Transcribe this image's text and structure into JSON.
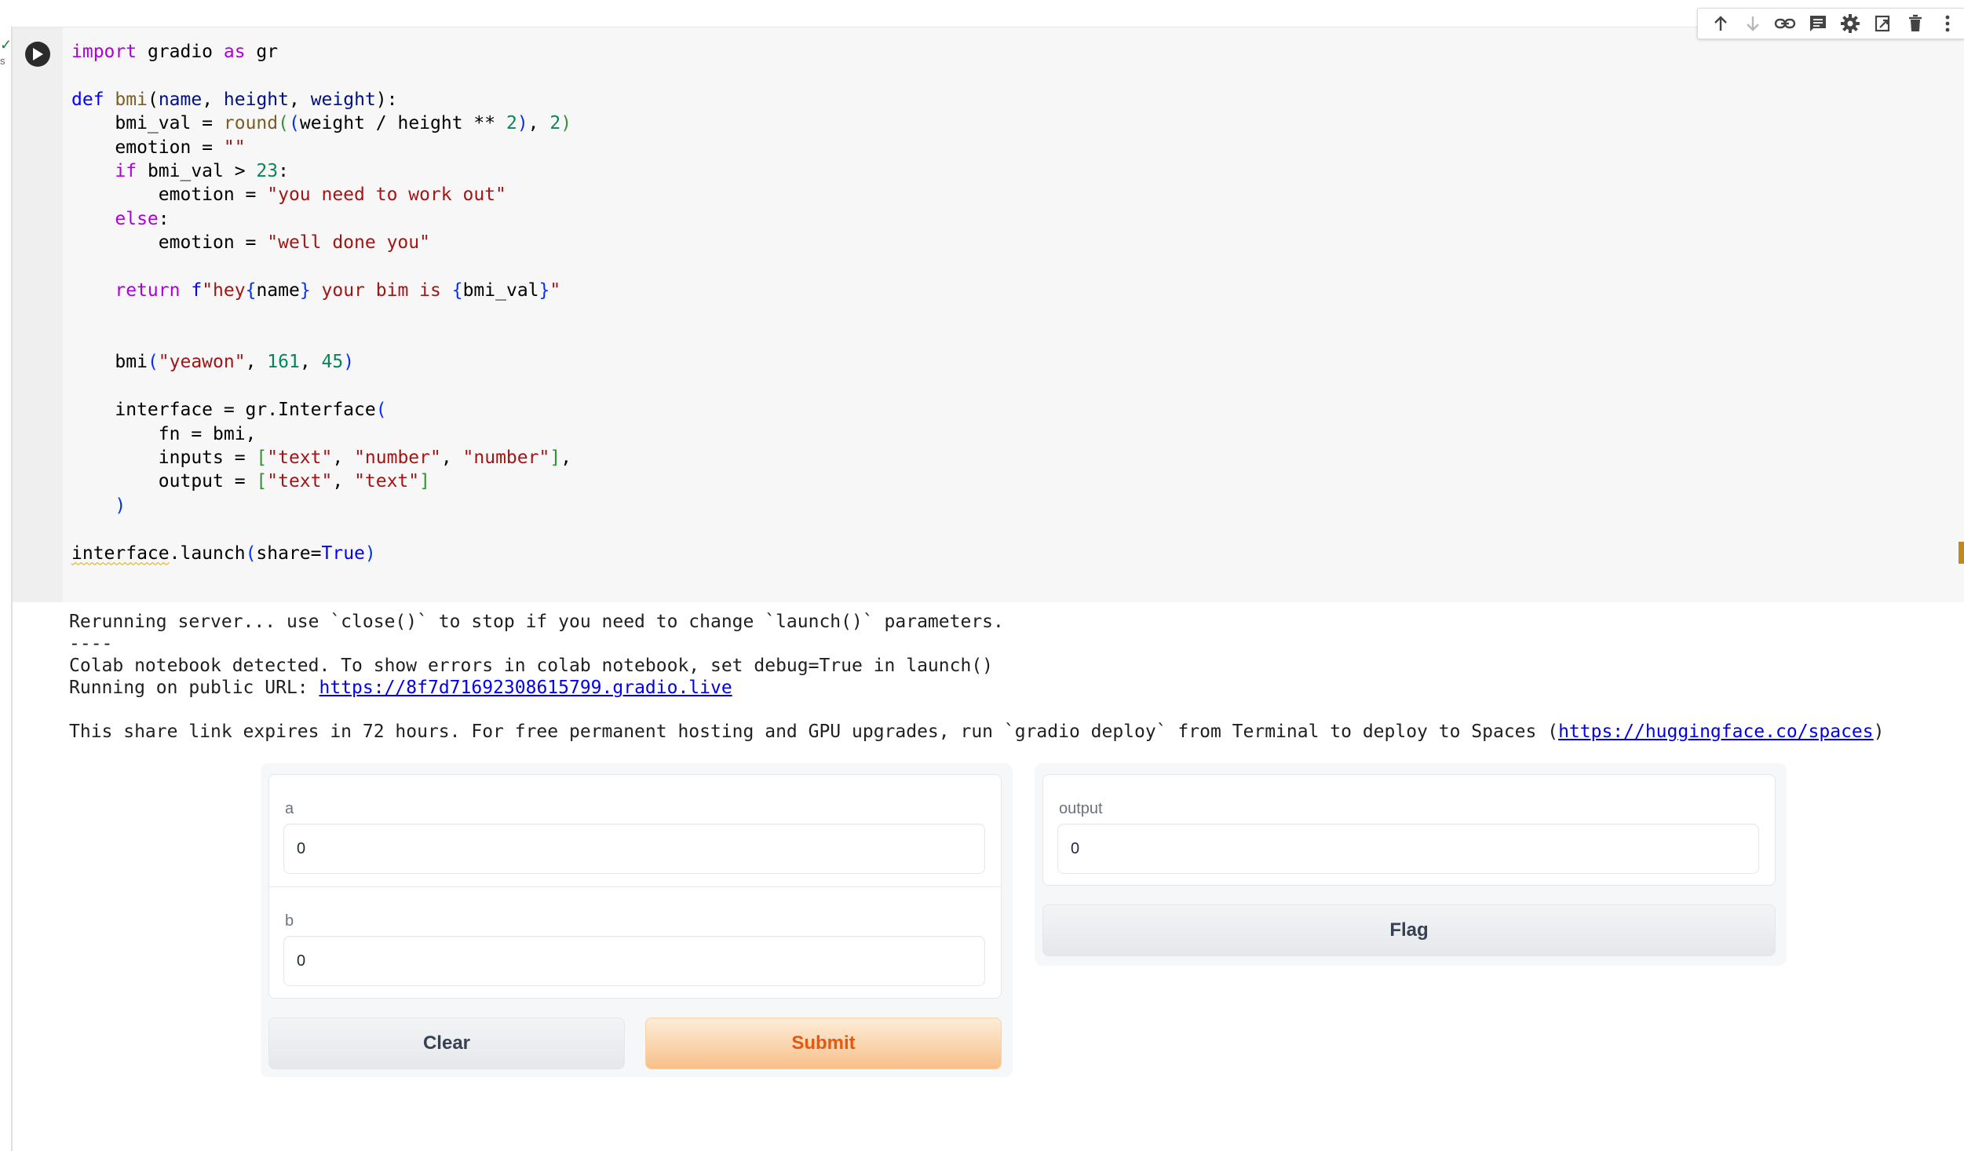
{
  "gutter": {
    "check": "✓",
    "status_suffix": "s"
  },
  "toolbar": {
    "icons": [
      "arrow-up-icon",
      "arrow-down-icon",
      "link-icon",
      "comment-icon",
      "gear-icon",
      "mirror-cell-icon",
      "trash-icon",
      "more-vert-icon"
    ]
  },
  "code": {
    "lines": [
      "import gradio as gr",
      "",
      "def bmi(name, height, weight):",
      "    bmi_val = round((weight / height ** 2), 2)",
      "    emotion = \"\"",
      "    if bmi_val > 23:",
      "        emotion = \"you need to work out\"",
      "    else:",
      "        emotion = \"well done you\"",
      "",
      "    return f\"hey{name} your bim is {bmi_val}\"",
      "",
      "",
      "    bmi(\"yeawon\", 161, 45)",
      "",
      "    interface = gr.Interface(",
      "        fn = bmi,",
      "        inputs = [\"text\", \"number\", \"number\"],",
      "        output = [\"text\", \"text\"]",
      "    )",
      "",
      "interface.launch(share=True)"
    ]
  },
  "output": {
    "line1": "Rerunning server... use `close()` to stop if you need to change `launch()` parameters.",
    "line2": "----",
    "line3": "Colab notebook detected. To show errors in colab notebook, set debug=True in launch()",
    "line4_prefix": "Running on public URL: ",
    "public_url": "https://8f7d71692308615799.gradio.live",
    "line5_prefix": "This share link expires in 72 hours. For free permanent hosting and GPU upgrades, run `gradio deploy` from Terminal to deploy to Spaces (",
    "spaces_url": "https://huggingface.co/spaces",
    "line5_suffix": ")"
  },
  "gradio": {
    "input_a": {
      "label": "a",
      "value": "0"
    },
    "input_b": {
      "label": "b",
      "value": "0"
    },
    "output": {
      "label": "output",
      "value": "0"
    },
    "clear_label": "Clear",
    "submit_label": "Submit",
    "flag_label": "Flag"
  },
  "colors": {
    "submit_text": "#e2590f",
    "keyword": "#af00db",
    "string": "#a31515",
    "number": "#098658",
    "link": "#0000ee"
  }
}
